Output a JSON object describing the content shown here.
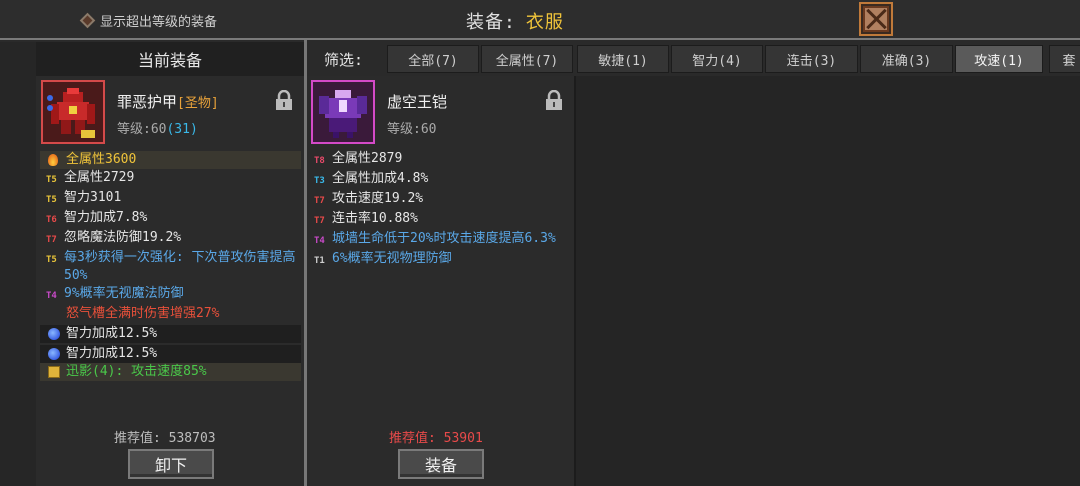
{
  "topbar": {
    "show_over_level": "显示超出等级的装备",
    "title": "装备:",
    "slot": "衣服"
  },
  "left": {
    "header": "当前装备",
    "item": {
      "name": "罪恶护甲",
      "tag": "[圣物]",
      "level_label": "等级:60",
      "level_plus": "(31)",
      "icon": "red-demon-armor-icon"
    },
    "stats": [
      {
        "tier": "",
        "text": "全属性3600",
        "color": "#f0c43a",
        "kind": "flame"
      },
      {
        "tier": "T5",
        "tier_color": "#e8c43a",
        "text": "全属性2729",
        "color": "#e6e6e6"
      },
      {
        "tier": "T5",
        "tier_color": "#e8c43a",
        "text": "智力3101",
        "color": "#e6e6e6"
      },
      {
        "tier": "T6",
        "tier_color": "#e84a4a",
        "text": "智力加成7.8%",
        "color": "#e6e6e6"
      },
      {
        "tier": "T7",
        "tier_color": "#e84a4a",
        "text": "忽略魔法防御19.2%",
        "color": "#e6e6e6"
      },
      {
        "tier": "T5",
        "tier_color": "#e8c43a",
        "text": "每3秒获得一次强化: 下次普攻伤害提高50%",
        "color": "#5aa8e8"
      },
      {
        "tier": "T4",
        "tier_color": "#c84ac8",
        "text": "9%概率无视魔法防御",
        "color": "#5aa8e8"
      },
      {
        "tier": "",
        "text": "怒气槽全满时伤害增强27%",
        "color": "#e8503a"
      },
      {
        "tier": "",
        "text": "智力加成12.5%",
        "color": "#e6e6e6",
        "kind": "gem"
      },
      {
        "tier": "",
        "text": "智力加成12.5%",
        "color": "#e6e6e6",
        "kind": "gem"
      },
      {
        "tier": "",
        "text": "迅影(4): 攻击速度85%",
        "color": "#4ac84a",
        "kind": "book"
      }
    ],
    "rec_label": "推荐值:",
    "rec_value": "538703",
    "button": "卸下"
  },
  "filter": {
    "label": "筛选:",
    "tabs": [
      "全部(7)",
      "全属性(7)",
      "敏捷(1)",
      "智力(4)",
      "连击(3)",
      "准确(3)",
      "攻速(1)",
      "套"
    ],
    "active": 6
  },
  "mid": {
    "item": {
      "name": "虚空王铠",
      "level_label": "等级:60",
      "icon": "void-king-armor-icon"
    },
    "stats": [
      {
        "tier": "T8",
        "tier_color": "#e84a6a",
        "text": "全属性2879",
        "color": "#e6e6e6"
      },
      {
        "tier": "T3",
        "tier_color": "#3ab8e8",
        "text": "全属性加成4.8%",
        "color": "#e6e6e6"
      },
      {
        "tier": "T7",
        "tier_color": "#e84a4a",
        "text": "攻击速度19.2%",
        "color": "#e6e6e6"
      },
      {
        "tier": "T7",
        "tier_color": "#e84a4a",
        "text": "连击率10.88%",
        "color": "#e6e6e6"
      },
      {
        "tier": "T4",
        "tier_color": "#c84ac8",
        "text": "城墙生命低于20%时攻击速度提高6.3%",
        "color": "#5aa8e8"
      },
      {
        "tier": "T1",
        "tier_color": "#cfcfcf",
        "text": "6%概率无视物理防御",
        "color": "#5aa8e8"
      }
    ],
    "rec_label": "推荐值:",
    "rec_value": "53901",
    "rec_color": "#e84a4a",
    "button": "装备"
  }
}
